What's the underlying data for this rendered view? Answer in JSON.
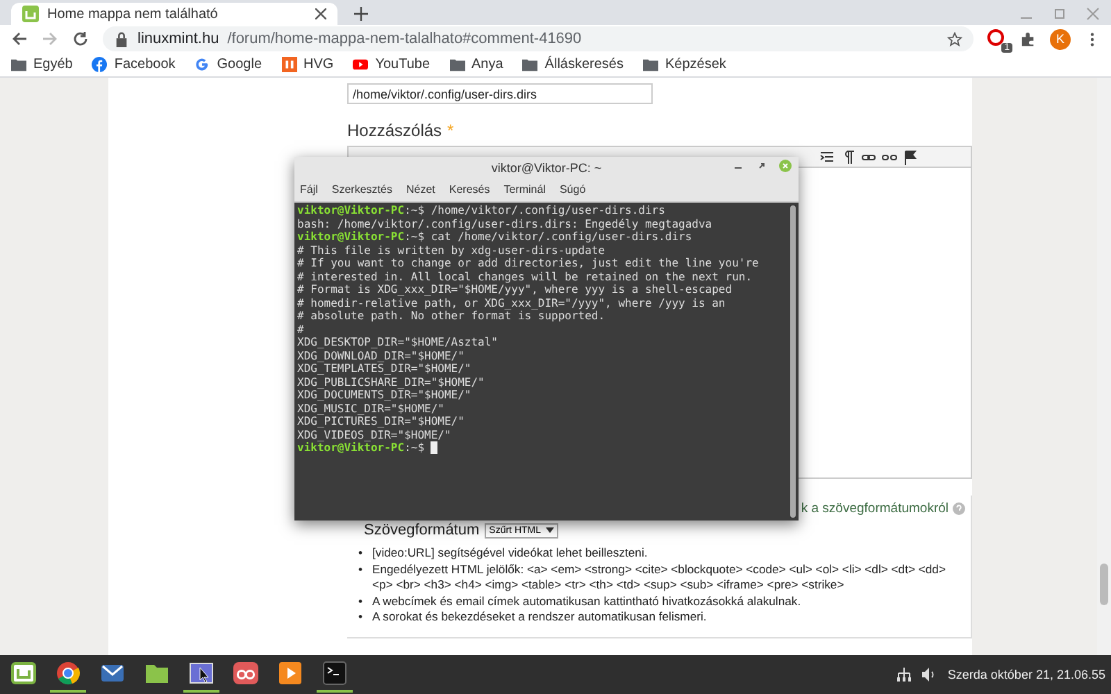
{
  "browser": {
    "tab_title": "Home mappa nem található",
    "url_host": "linuxmint.hu",
    "url_path": "/forum/home-mappa-nem-talalhato#comment-41690",
    "profile_initial": "K",
    "extension_badge": "1",
    "bookmarks": [
      {
        "kind": "folder",
        "label": "Egyéb"
      },
      {
        "kind": "facebook",
        "label": "Facebook"
      },
      {
        "kind": "google",
        "label": "Google"
      },
      {
        "kind": "hvg",
        "label": "HVG"
      },
      {
        "kind": "youtube",
        "label": "YouTube"
      },
      {
        "kind": "folder",
        "label": "Anya"
      },
      {
        "kind": "folder",
        "label": "Álláskeresés"
      },
      {
        "kind": "folder",
        "label": "Képzések"
      }
    ]
  },
  "page": {
    "path_field": "/home/viktor/.config/user-dirs.dirs",
    "comment_label": "Hozzászólás",
    "required_mark": "*",
    "format_help_link": "k a szövegformátumokról",
    "format_label": "Szövegformátum",
    "format_select": "Szűrt HTML",
    "tips": [
      {
        "bullet": "•",
        "text": "[video:URL] segítségével videókat lehet beilleszteni."
      },
      {
        "bullet": "•",
        "text": "Engedélyezett HTML jelölők: <a> <em> <strong> <cite> <blockquote> <code> <ul> <ol> <li> <dl> <dt> <dd> <p> <br> <h3> <h4> <img> <table> <tr> <th> <td> <sup> <sub> <iframe> <pre> <strike>"
      },
      {
        "bullet": "•",
        "text": "A webcímek és email címek automatikusan kattintható hivatkozásokká alakulnak."
      },
      {
        "bullet": "•",
        "text": "A sorokat és bekezdéseket a rendszer automatikusan felismeri."
      }
    ]
  },
  "terminal": {
    "title": "viktor@Viktor-PC: ~",
    "menu": [
      "Fájl",
      "Szerkesztés",
      "Nézet",
      "Keresés",
      "Terminál",
      "Súgó"
    ],
    "lines": [
      {
        "kind": "prompt",
        "user": "viktor@Viktor-PC",
        "path": ":~$ ",
        "text": "/home/viktor/.config/user-dirs.dirs"
      },
      {
        "kind": "output",
        "text": "bash: /home/viktor/.config/user-dirs.dirs: Engedély megtagadva"
      },
      {
        "kind": "prompt",
        "user": "viktor@Viktor-PC",
        "path": ":~$ ",
        "text": "cat /home/viktor/.config/user-dirs.dirs"
      },
      {
        "kind": "output",
        "text": "# This file is written by xdg-user-dirs-update"
      },
      {
        "kind": "output",
        "text": "# If you want to change or add directories, just edit the line you're"
      },
      {
        "kind": "output",
        "text": "# interested in. All local changes will be retained on the next run."
      },
      {
        "kind": "output",
        "text": "# Format is XDG_xxx_DIR=\"$HOME/yyy\", where yyy is a shell-escaped"
      },
      {
        "kind": "output",
        "text": "# homedir-relative path, or XDG_xxx_DIR=\"/yyy\", where /yyy is an"
      },
      {
        "kind": "output",
        "text": "# absolute path. No other format is supported."
      },
      {
        "kind": "output",
        "text": "#"
      },
      {
        "kind": "output",
        "text": "XDG_DESKTOP_DIR=\"$HOME/Asztal\""
      },
      {
        "kind": "output",
        "text": "XDG_DOWNLOAD_DIR=\"$HOME/\""
      },
      {
        "kind": "output",
        "text": "XDG_TEMPLATES_DIR=\"$HOME/\""
      },
      {
        "kind": "output",
        "text": "XDG_PUBLICSHARE_DIR=\"$HOME/\""
      },
      {
        "kind": "output",
        "text": "XDG_DOCUMENTS_DIR=\"$HOME/\""
      },
      {
        "kind": "output",
        "text": "XDG_MUSIC_DIR=\"$HOME/\""
      },
      {
        "kind": "output",
        "text": "XDG_PICTURES_DIR=\"$HOME/\""
      },
      {
        "kind": "output",
        "text": "XDG_VIDEOS_DIR=\"$HOME/\""
      },
      {
        "kind": "prompt",
        "user": "viktor@Viktor-PC",
        "path": ":~$ "
      }
    ]
  },
  "taskbar": {
    "apps": [
      {
        "kind": "menu",
        "running": false
      },
      {
        "kind": "chrome",
        "running": true
      },
      {
        "kind": "mail",
        "running": false
      },
      {
        "kind": "files",
        "running": false
      },
      {
        "kind": "screenshot",
        "running": true
      },
      {
        "kind": "glasses",
        "running": false
      },
      {
        "kind": "player",
        "running": false
      },
      {
        "kind": "terminal",
        "running": true
      }
    ],
    "clock": "Szerda október 21, 21.06.55"
  }
}
